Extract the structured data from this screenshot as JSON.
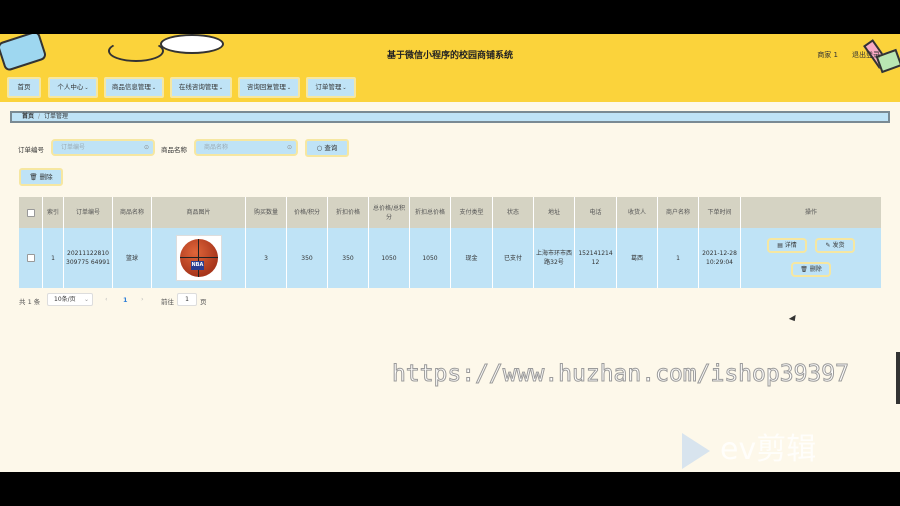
{
  "header": {
    "title": "基于微信小程序的校园商铺系统",
    "user": "商家 1",
    "logout": "退出登录"
  },
  "nav": [
    {
      "label": "首页",
      "caret": false
    },
    {
      "label": "个人中心",
      "caret": true
    },
    {
      "label": "商品信息管理",
      "caret": true
    },
    {
      "label": "在线咨询管理",
      "caret": true
    },
    {
      "label": "咨询回复管理",
      "caret": true
    },
    {
      "label": "订单管理",
      "caret": true
    }
  ],
  "breadcrumb": {
    "home": "首页",
    "current": "订单管理"
  },
  "search": {
    "order_label": "订单编号",
    "order_placeholder": "订单编号",
    "product_label": "商品名称",
    "product_placeholder": "商品名称",
    "query_button": "查询",
    "delete_button": "删除"
  },
  "table": {
    "headers": [
      "索引",
      "订单编号",
      "商品名称",
      "商品图片",
      "购买数量",
      "价格/积分",
      "折扣价格",
      "总价格/总积分",
      "折扣总价格",
      "支付类型",
      "状态",
      "地址",
      "电话",
      "收货人",
      "商户名称",
      "下单时间",
      "操作"
    ],
    "rows": [
      {
        "index": "1",
        "order_no": "20211122810309775 64991",
        "product": "篮球",
        "image_text": "NBA",
        "quantity": "3",
        "price": "350",
        "discount_price": "350",
        "total": "1050",
        "discount_total": "1050",
        "pay_type": "现金",
        "status": "已支付",
        "address": "上海市环市西路32号",
        "phone": "15214121412",
        "receiver": "葛西",
        "merchant": "1",
        "time": "2021-12-28 10:29:04"
      }
    ],
    "actions": {
      "detail": "详情",
      "ship": "发货",
      "delete": "删除"
    }
  },
  "pagination": {
    "total": "共 1 条",
    "page_size": "10条/页",
    "current_page": "1",
    "goto_label": "前往",
    "goto_value": "1",
    "page_unit": "页"
  },
  "watermark": "https://www.huzhan.com/ishop39397",
  "ev_logo": "ev剪辑"
}
